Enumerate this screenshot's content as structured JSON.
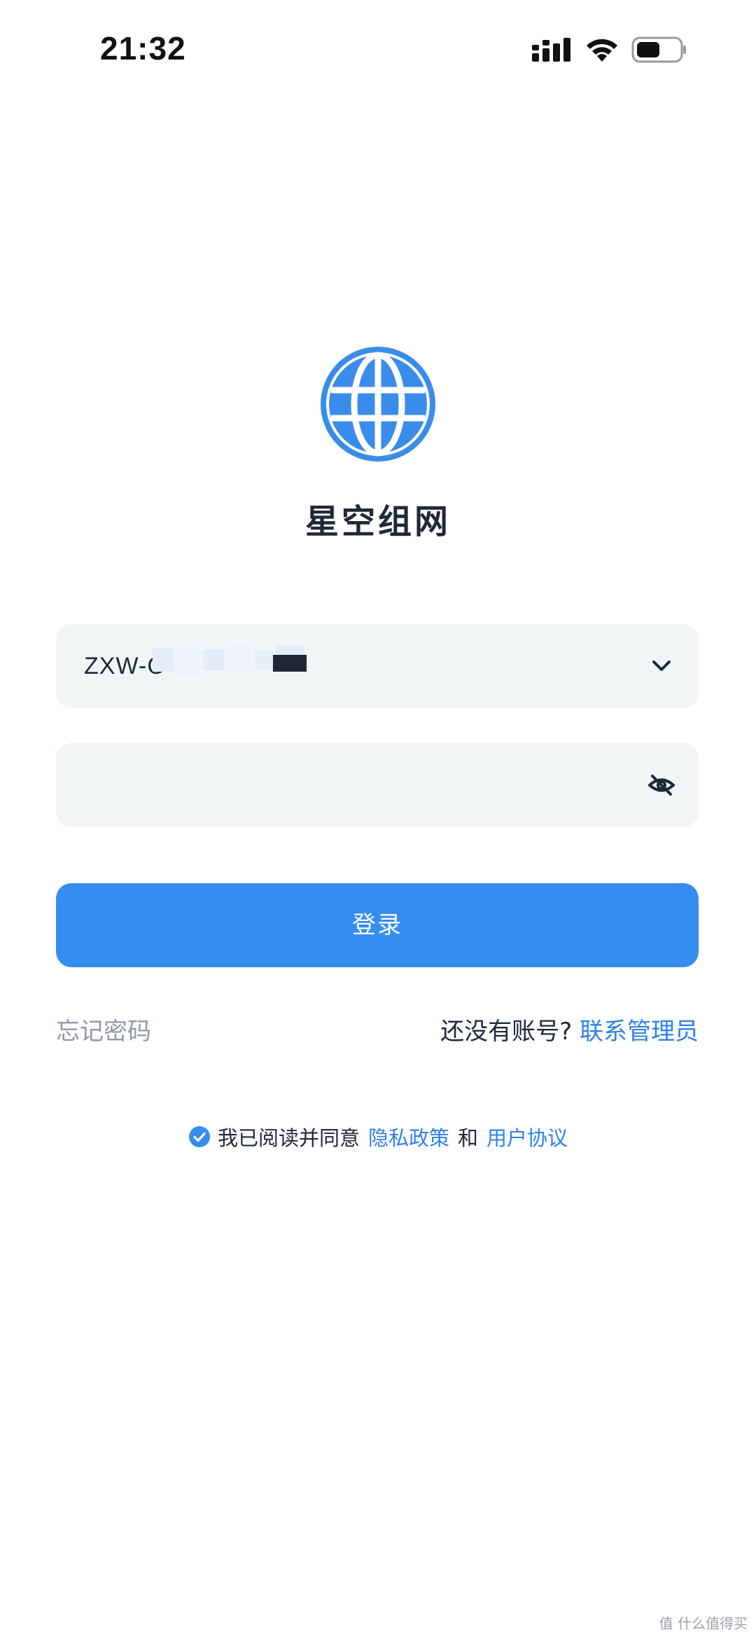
{
  "status_bar": {
    "time": "21:32",
    "icons": [
      "signal-icon",
      "wifi-icon",
      "battery-icon"
    ]
  },
  "app": {
    "logo_icon": "globe-icon",
    "title": "星空组网",
    "accent_color": "#368df0"
  },
  "login_form": {
    "account_value": "ZXW-C",
    "account_redacted": true,
    "account_dropdown_icon": "chevron-down-icon",
    "password_value": "",
    "password_toggle_icon": "eye-off-icon",
    "submit_label": "登录"
  },
  "links": {
    "forgot_password": "忘记密码",
    "no_account_prompt": "还没有账号?",
    "contact_admin": "联系管理员"
  },
  "agreement": {
    "checked": true,
    "text": "我已阅读并同意",
    "privacy_policy": "隐私政策",
    "and": "和",
    "user_agreement": "用户协议"
  },
  "watermark": "值 什么值得买"
}
